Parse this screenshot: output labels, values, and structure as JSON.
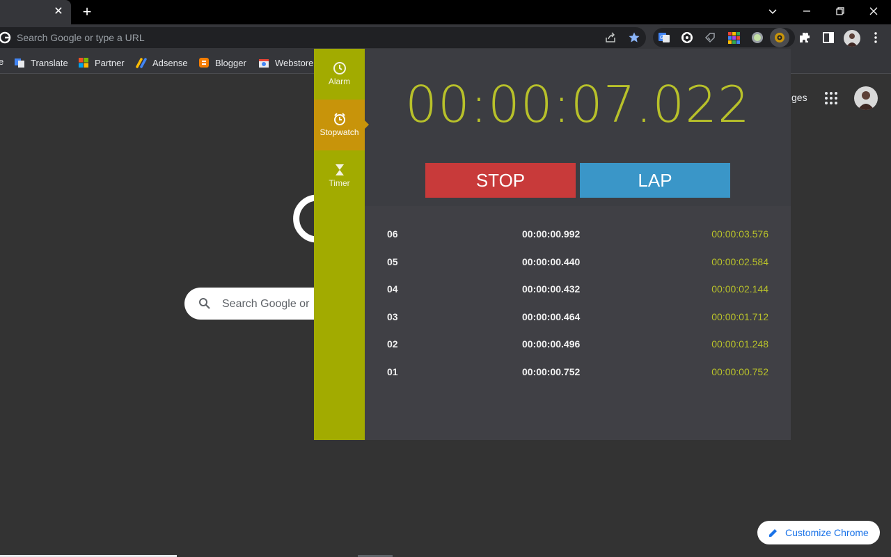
{
  "browser": {
    "omnibox_placeholder": "Search Google or type a URL",
    "bookmarks": [
      {
        "label": "Translate"
      },
      {
        "label": "Partner"
      },
      {
        "label": "Adsense"
      },
      {
        "label": "Blogger"
      },
      {
        "label": "Webstore"
      }
    ],
    "tab_close": "✕",
    "new_tab": "+"
  },
  "ntp": {
    "images_link": "ges",
    "search_placeholder": "Search Google or",
    "customize_label": "Customize Chrome"
  },
  "popup": {
    "sidebar": [
      {
        "label": "Alarm",
        "icon": "alarm-clock-icon",
        "active": false
      },
      {
        "label": "Stopwatch",
        "icon": "stopwatch-icon",
        "active": true
      },
      {
        "label": "Timer",
        "icon": "hourglass-icon",
        "active": false
      }
    ],
    "time": "00:00:07.022",
    "stop_label": "STOP",
    "lap_label": "LAP",
    "laps": [
      {
        "num": "06",
        "split": "00:00:00.992",
        "total": "00:00:03.576"
      },
      {
        "num": "05",
        "split": "00:00:00.440",
        "total": "00:00:02.584"
      },
      {
        "num": "04",
        "split": "00:00:00.432",
        "total": "00:00:02.144"
      },
      {
        "num": "03",
        "split": "00:00:00.464",
        "total": "00:00:01.712"
      },
      {
        "num": "02",
        "split": "00:00:00.496",
        "total": "00:00:01.248"
      },
      {
        "num": "01",
        "split": "00:00:00.752",
        "total": "00:00:00.752"
      }
    ]
  },
  "colors": {
    "accent_green": "#b8c12a",
    "sidebar_green": "#a2ab00",
    "active_orange": "#c8940a",
    "stop_red": "#c83a3a",
    "lap_blue": "#3a96c8"
  }
}
